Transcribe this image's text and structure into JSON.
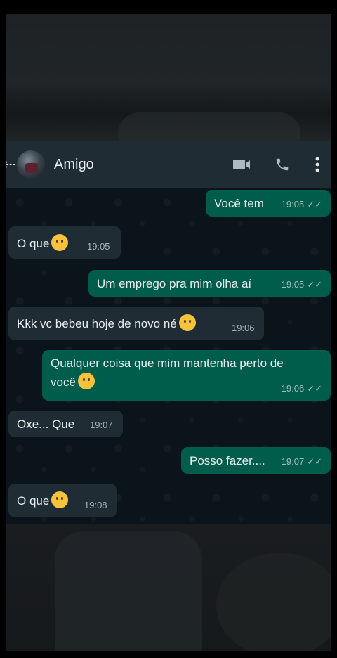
{
  "header": {
    "contact_name": "Amigo"
  },
  "icons": {
    "back": "back-arrow-icon",
    "video": "video-call-icon",
    "phone": "phone-icon",
    "menu": "more-vert-icon",
    "thinking": "thinking-face-emoji",
    "laughing": "laughing-tears-emoji",
    "pleading": "pleading-face-emoji"
  },
  "colors": {
    "incoming": "#1f2c33",
    "outgoing": "#005c4b",
    "wallpaper": "#0b141a"
  },
  "messages": [
    {
      "text": "Você tem",
      "time": "19:05",
      "dir": "out"
    },
    {
      "text": "O que",
      "time": "19:05",
      "dir": "in"
    },
    {
      "text": "Um emprego pra mim olha aí",
      "time": "19:05",
      "dir": "out"
    },
    {
      "text": "Kkk vc bebeu hoje de novo né",
      "time": "19:06",
      "dir": "in"
    },
    {
      "text_line1": "Qualquer coisa que mim mantenha perto de",
      "text_line2": "você",
      "time": "19:06",
      "dir": "out"
    },
    {
      "text": "Oxe... Que",
      "time": "19:07",
      "dir": "in"
    },
    {
      "text": "Posso fazer....",
      "time": "19:07",
      "dir": "out"
    },
    {
      "text": "O que",
      "time": "19:08",
      "dir": "in"
    }
  ]
}
